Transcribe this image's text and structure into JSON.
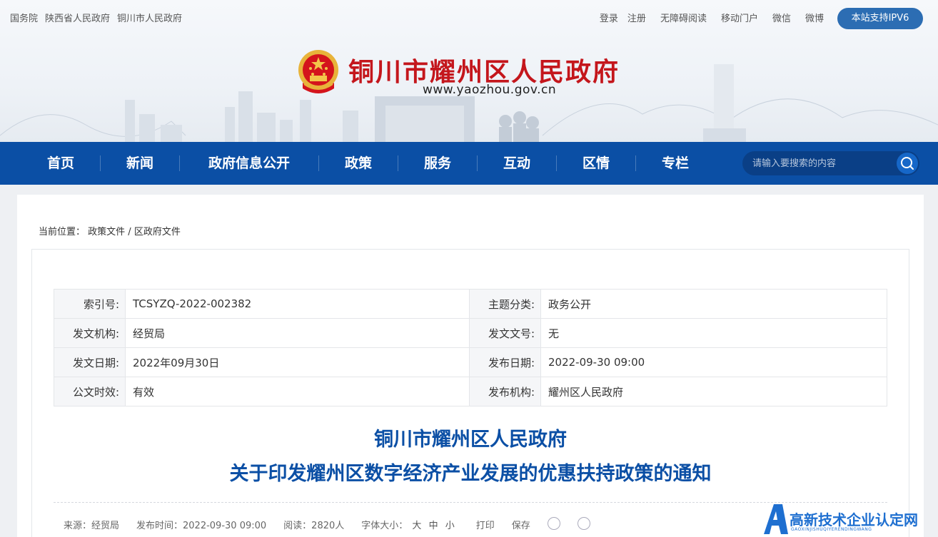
{
  "topbar": {
    "left_links": [
      "国务院",
      "陕西省人民政府",
      "铜川市人民政府"
    ],
    "right_links": [
      "登录",
      "注册",
      "无障碍阅读",
      "移动门户",
      "微信",
      "微博"
    ],
    "ipv6_label": "本站支持IPV6"
  },
  "header": {
    "site_title": "铜川市耀州区人民政府",
    "site_url": "www.yaozhou.gov.cn"
  },
  "nav": {
    "items": [
      "首页",
      "新闻",
      "政府信息公开",
      "政策",
      "服务",
      "互动",
      "区情",
      "专栏"
    ],
    "search_placeholder": "请输入要搜索的内容"
  },
  "breadcrumb": {
    "prefix": "当前位置：",
    "items": [
      "政策文件",
      "区政府文件"
    ],
    "separator": " / "
  },
  "meta": {
    "rows": [
      {
        "k1": "索引号:",
        "v1": "TCSYZQ-2022-002382",
        "k2": "主题分类:",
        "v2": "政务公开"
      },
      {
        "k1": "发文机构:",
        "v1": "经贸局",
        "k2": "发文文号:",
        "v2": "无"
      },
      {
        "k1": "发文日期:",
        "v1": "2022年09月30日",
        "k2": "发布日期:",
        "v2": "2022-09-30 09:00"
      },
      {
        "k1": "公文时效:",
        "v1": "有效",
        "k2": "发布机构:",
        "v2": "耀州区人民政府"
      }
    ]
  },
  "doc": {
    "title_line1": "铜川市耀州区人民政府",
    "title_line2": "关于印发耀州区数字经济产业发展的优惠扶持政策的通知"
  },
  "info": {
    "source": "来源：经贸局",
    "publish_time": "发布时间：2022-09-30 09:00",
    "reads": "阅读：2820人",
    "font_size_label": "字体大小：",
    "font_sizes": [
      "大",
      "中",
      "小"
    ],
    "print": "打印",
    "save": "保存"
  },
  "watermark": {
    "text": "高新技术企业认定网",
    "sub": "GAOXINJISHUQIYERENDINGWANG"
  },
  "colors": {
    "nav_blue": "#0b4fa5",
    "title_red": "#c4161c",
    "doc_title_blue": "#0b4fa5",
    "valid_green": "#2a8a2a"
  }
}
